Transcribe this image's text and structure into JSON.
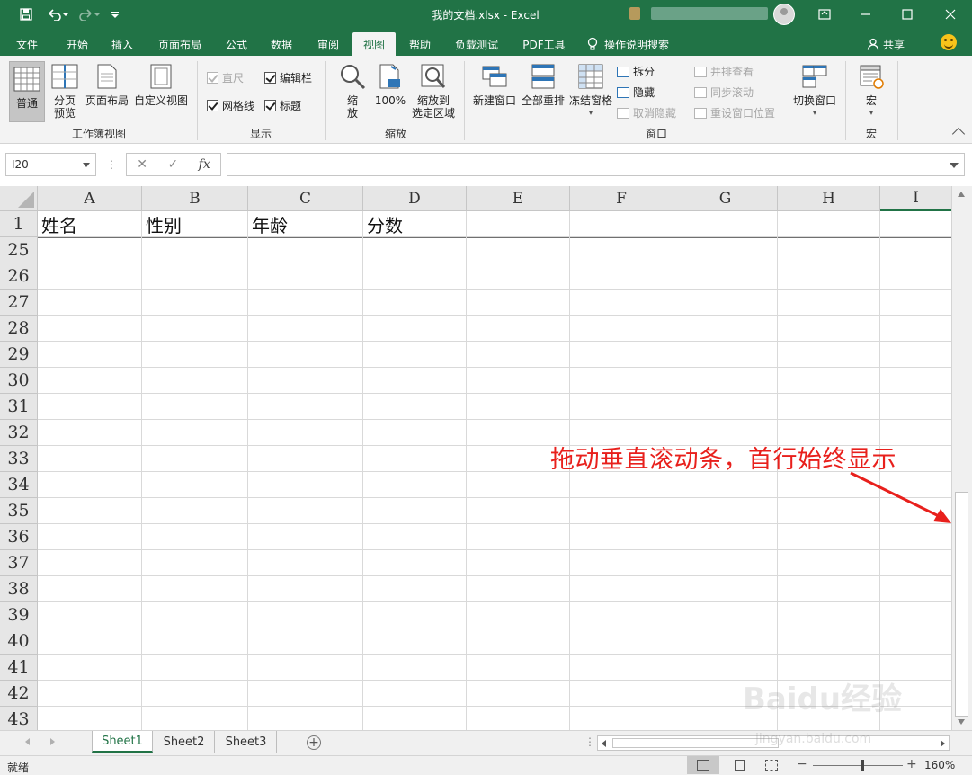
{
  "titlebar": {
    "title": "我的文档.xlsx  -  Excel",
    "icons": [
      "save-icon",
      "undo-icon",
      "redo-icon",
      "customize-qat-icon",
      "ribbon-display-icon",
      "minimize-icon",
      "maximize-icon",
      "close-icon"
    ]
  },
  "tabs": [
    {
      "label": "文件"
    },
    {
      "label": "开始"
    },
    {
      "label": "插入"
    },
    {
      "label": "页面布局"
    },
    {
      "label": "公式"
    },
    {
      "label": "数据"
    },
    {
      "label": "审阅"
    },
    {
      "label": "视图"
    },
    {
      "label": "帮助"
    },
    {
      "label": "负载测试"
    },
    {
      "label": "PDF工具"
    }
  ],
  "tellme": "操作说明搜索",
  "share": "共享",
  "ribbon": {
    "workbook_views": {
      "normal": "普通",
      "page_break_1": "分页",
      "page_break_2": "预览",
      "page_layout": "页面布局",
      "custom": "自定义视图",
      "group": "工作簿视图"
    },
    "show": {
      "ruler": "直尺",
      "formula_bar": "编辑栏",
      "gridlines": "网格线",
      "headings": "标题",
      "group": "显示"
    },
    "zoom": {
      "zoom_1": "缩",
      "zoom_2": "放",
      "hundred": "100%",
      "to_selection_1": "缩放到",
      "to_selection_2": "选定区域",
      "group": "缩放"
    },
    "window": {
      "new_window": "新建窗口",
      "arrange_all": "全部重排",
      "freeze_panes": "冻结窗格",
      "split": "拆分",
      "hide": "隐藏",
      "unhide": "取消隐藏",
      "side_by_side": "并排查看",
      "sync_scroll": "同步滚动",
      "reset_position": "重设窗口位置",
      "switch_windows": "切换窗口",
      "group": "窗口"
    },
    "macros": {
      "label": "宏",
      "group": "宏"
    }
  },
  "formula_bar": {
    "name_box": "I20",
    "fx": "fx",
    "cancel": "✕",
    "enter": "✓",
    "value": ""
  },
  "columns": [
    "A",
    "B",
    "C",
    "D",
    "E",
    "F",
    "G",
    "H",
    "I"
  ],
  "header_row": {
    "row_number": "1",
    "cells": [
      "姓名",
      "性别",
      "年龄",
      "分数",
      "",
      "",
      "",
      "",
      ""
    ]
  },
  "visible_rows": [
    "25",
    "26",
    "27",
    "28",
    "29",
    "30",
    "31",
    "32",
    "33",
    "34",
    "35",
    "36",
    "37",
    "38",
    "39",
    "40",
    "41",
    "42",
    "43"
  ],
  "annotation": "拖动垂直滚动条，首行始终显示",
  "sheets": [
    {
      "name": "Sheet1",
      "active": true
    },
    {
      "name": "Sheet2",
      "active": false
    },
    {
      "name": "Sheet3",
      "active": false
    }
  ],
  "status": {
    "ready": "就绪",
    "zoom": "160%",
    "zoom_minus": "−",
    "zoom_plus": "+"
  },
  "watermark": {
    "brand": "Baidu经验",
    "url": "jingyan.baidu.com"
  },
  "colors": {
    "excel_green": "#217346",
    "annotation_red": "#e8201c"
  }
}
